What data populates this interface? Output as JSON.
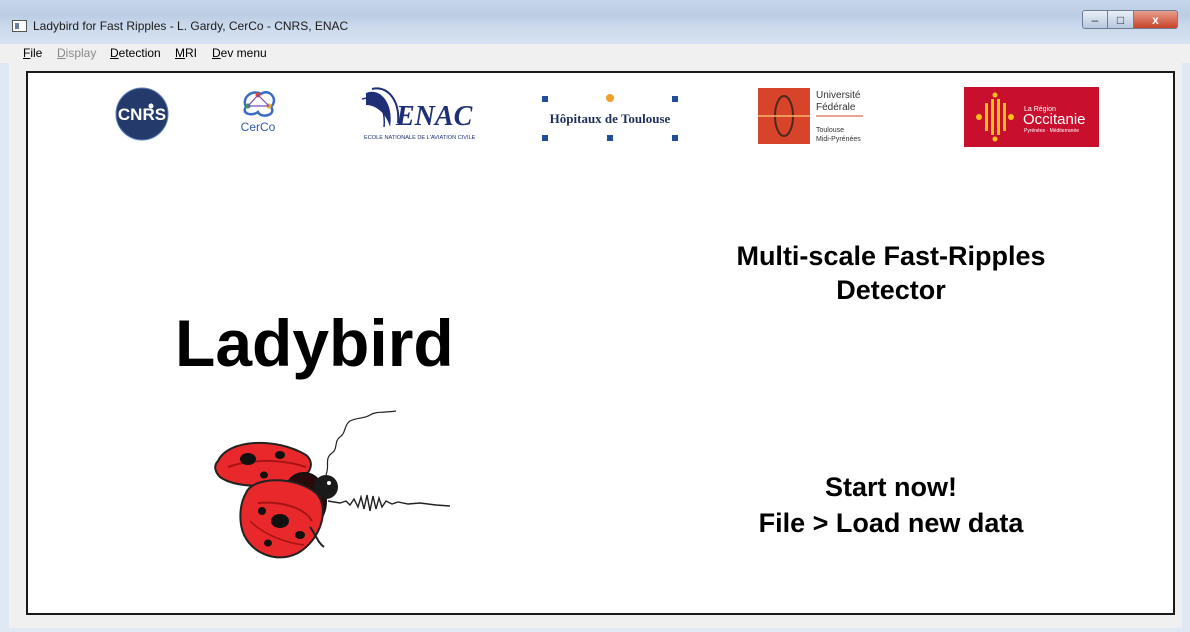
{
  "window": {
    "title": "Ladybird for Fast Ripples - L. Gardy, CerCo - CNRS, ENAC",
    "buttons": {
      "minimize": "–",
      "maximize": "□",
      "close": "x"
    }
  },
  "menu": {
    "items": [
      {
        "label": "File",
        "enabled": true
      },
      {
        "label": "Display",
        "enabled": false
      },
      {
        "label": "Detection",
        "enabled": true
      },
      {
        "label": "MRI",
        "enabled": true
      },
      {
        "label": "Dev menu",
        "enabled": true
      }
    ]
  },
  "logos": {
    "cnrs": "CNRS",
    "cerco": "CerCo",
    "enac": "ENAC",
    "enac_sub": "ECOLE NATIONALE DE L'AVIATION CIVILE",
    "hopitaux": "Hôpitaux de Toulouse",
    "univ_line1": "Université",
    "univ_line2": "Fédérale",
    "univ_line3": "Toulouse",
    "univ_line4": "Midi-Pyrénées",
    "region_line1": "La Région",
    "region_line2": "Occitanie",
    "region_line3": "Pyrénées · Méditerranée"
  },
  "content": {
    "app_name": "Ladybird",
    "subtitle_line1": "Multi-scale Fast-Ripples",
    "subtitle_line2": "Detector",
    "start_line1": "Start now!",
    "start_line2": "File > Load new data"
  },
  "colors": {
    "ladybird_red": "#e8282a",
    "region_red": "#c8102e",
    "hopitaux_blue": "#1f4e9b",
    "hopitaux_orange": "#f0a028"
  }
}
